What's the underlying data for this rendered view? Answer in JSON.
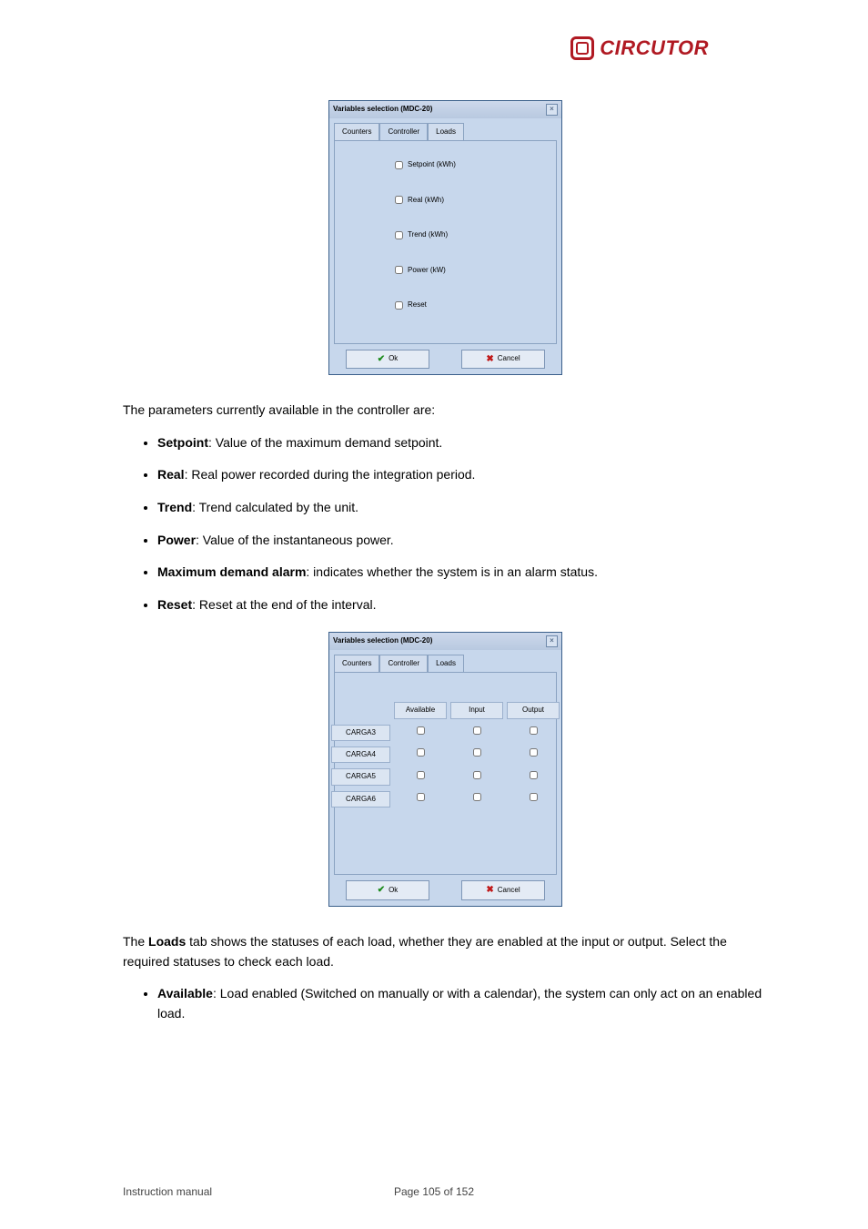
{
  "logo": {
    "brand": "CIRCUTOR"
  },
  "dialog1": {
    "title": "Variables selection (MDC-20)",
    "tabs": {
      "counters": "Counters",
      "controller": "Controller",
      "loads": "Loads"
    },
    "items": [
      {
        "label": "Setpoint (kWh)"
      },
      {
        "label": "Real (kWh)"
      },
      {
        "label": "Trend (kWh)"
      },
      {
        "label": "Power (kW)"
      },
      {
        "label": "Reset"
      }
    ],
    "ok": "Ok",
    "cancel": "Cancel"
  },
  "doc": {
    "p1": "The parameters currently available in the controller are:",
    "bullets1": [
      {
        "b": "Setpoint",
        "rest": ": Value of the maximum demand setpoint."
      },
      {
        "b": "Real",
        "rest": ": Real power recorded during the integration period."
      },
      {
        "b": "Trend",
        "rest": ": Trend calculated by the unit."
      },
      {
        "b": "Power",
        "rest": ": Value of the instantaneous power."
      },
      {
        "b": "Maximum demand alarm",
        "rest": ": indicates whether the system is in an alarm status."
      },
      {
        "b": "Reset",
        "rest": ": Reset at the end of the interval."
      }
    ],
    "p2_a": "The ",
    "p2_b": "Loads",
    "p2_c": " tab shows the statuses of each load, whether they are enabled at the input or output. Select the required statuses to check each load.",
    "li2_b": "Available",
    "li2_rest": ": Load enabled (Switched on manually or with a calendar), the system can only act on an enabled load.",
    "footer_left": "Instruction manual",
    "footer_center": "Page 105 of 152"
  },
  "dialog2": {
    "title": "Variables selection (MDC-20)",
    "tabs": {
      "counters": "Counters",
      "controller": "Controller",
      "loads": "Loads"
    },
    "headers": {
      "available": "Available",
      "input": "Input",
      "output": "Output"
    },
    "rows": [
      {
        "name": "CARGA3"
      },
      {
        "name": "CARGA4"
      },
      {
        "name": "CARGA5"
      },
      {
        "name": "CARGA6"
      }
    ],
    "ok": "Ok",
    "cancel": "Cancel"
  }
}
